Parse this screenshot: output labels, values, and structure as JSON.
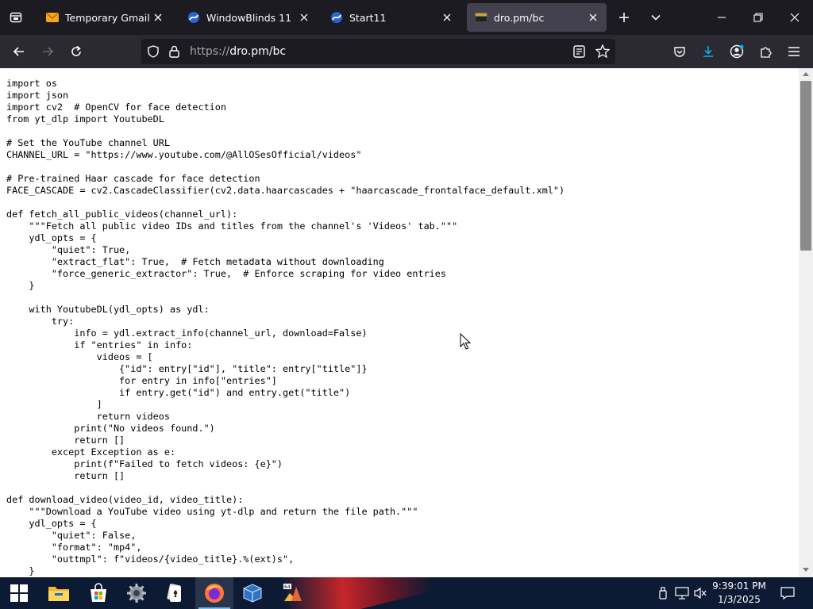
{
  "tabs": [
    {
      "title": "Temporary Gmail Acco",
      "icon": "gmail-envelope-icon"
    },
    {
      "title": "WindowBlinds 11",
      "icon": "stardock-icon"
    },
    {
      "title": "Start11",
      "icon": "stardock-icon"
    },
    {
      "title": "dro.pm/bc",
      "icon": "page-thumbnail-icon",
      "active": true
    }
  ],
  "address": {
    "prefix": "https://",
    "host": "dro.pm/bc"
  },
  "code_lines": [
    "import os",
    "import json",
    "import cv2  # OpenCV for face detection",
    "from yt_dlp import YoutubeDL",
    "",
    "# Set the YouTube channel URL",
    "CHANNEL_URL = \"https://www.youtube.com/@AllOSesOfficial/videos\"",
    "",
    "# Pre-trained Haar cascade for face detection",
    "FACE_CASCADE = cv2.CascadeClassifier(cv2.data.haarcascades + \"haarcascade_frontalface_default.xml\")",
    "",
    "def fetch_all_public_videos(channel_url):",
    "    \"\"\"Fetch all public video IDs and titles from the channel's 'Videos' tab.\"\"\"",
    "    ydl_opts = {",
    "        \"quiet\": True,",
    "        \"extract_flat\": True,  # Fetch metadata without downloading",
    "        \"force_generic_extractor\": True,  # Enforce scraping for video entries",
    "    }",
    "",
    "    with YoutubeDL(ydl_opts) as ydl:",
    "        try:",
    "            info = ydl.extract_info(channel_url, download=False)",
    "            if \"entries\" in info:",
    "                videos = [",
    "                    {\"id\": entry[\"id\"], \"title\": entry[\"title\"]}",
    "                    for entry in info[\"entries\"]",
    "                    if entry.get(\"id\") and entry.get(\"title\")",
    "                ]",
    "                return videos",
    "            print(\"No videos found.\")",
    "            return []",
    "        except Exception as e:",
    "            print(f\"Failed to fetch videos: {e}\")",
    "            return []",
    "",
    "def download_video(video_id, video_title):",
    "    \"\"\"Download a YouTube video using yt-dlp and return the file path.\"\"\"",
    "    ydl_opts = {",
    "        \"quiet\": False,",
    "        \"format\": \"mp4\",",
    "        \"outtmpl\": f\"videos/{video_title}.%(ext)s\",",
    "    }"
  ],
  "taskbar": {
    "apps": [
      "start-icon",
      "file-explorer-icon",
      "microsoft-store-icon",
      "settings-gear-icon",
      "solitaire-icon",
      "firefox-icon",
      "virtualbox-icon",
      "matlab-icon"
    ],
    "time": "9:39:01 PM",
    "date": "1/3/2025"
  },
  "colors": {
    "tab_bar": "#1c1b22",
    "toolbar": "#2b2a33",
    "urlbar": "#1c1b22",
    "download_accent": "#00b3f4",
    "taskbar": "#0c1a33"
  }
}
